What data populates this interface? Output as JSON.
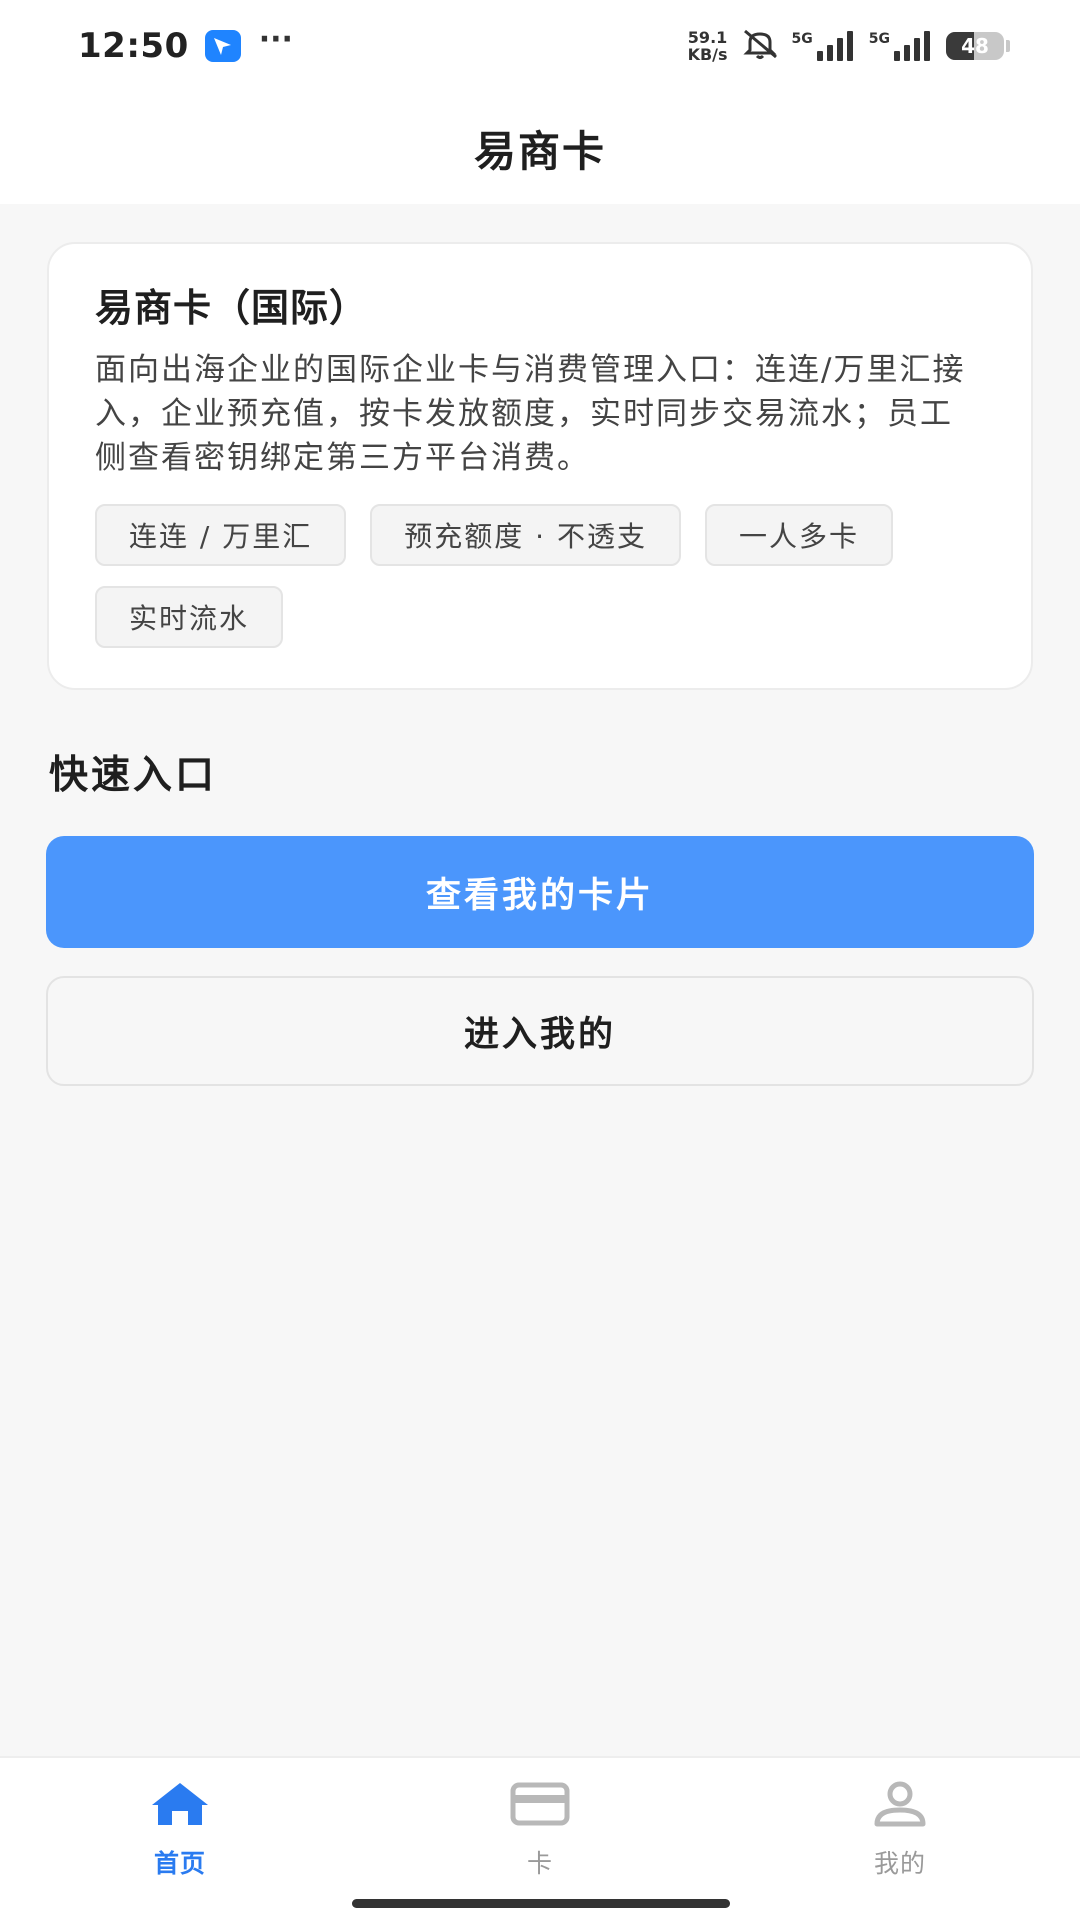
{
  "status_bar": {
    "time": "12:50",
    "speed_value": "59.1",
    "speed_unit": "KB/s",
    "sim1_label": "5G",
    "sim2_label": "5G",
    "battery_level": "48",
    "battery_fraction": 0.48,
    "app_icon": "feishu-like-app-icon",
    "more_icon": "ellipsis-icon",
    "mute_icon": "bell-off-icon"
  },
  "header": {
    "title": "易商卡"
  },
  "intro_card": {
    "title": "易商卡（国际）",
    "description": "面向出海企业的国际企业卡与消费管理入口：连连/万里汇接入，企业预充值，按卡发放额度，实时同步交易流水；员工侧查看密钥绑定第三方平台消费。",
    "tags": [
      "连连 / 万里汇",
      "预充额度 · 不透支",
      "一人多卡",
      "实时流水"
    ]
  },
  "quick_entry": {
    "title": "快速入口",
    "primary_button": "查看我的卡片",
    "secondary_button": "进入我的"
  },
  "bottom_nav": {
    "items": [
      {
        "label": "首页",
        "icon": "home-icon",
        "active": true
      },
      {
        "label": "卡",
        "icon": "card-icon",
        "active": false
      },
      {
        "label": "我的",
        "icon": "user-icon",
        "active": false
      }
    ]
  },
  "colors": {
    "accent": "#4b96fc",
    "nav_active": "#2a7bf0",
    "nav_inactive": "#b8b8b8",
    "background": "#f7f7f7"
  }
}
